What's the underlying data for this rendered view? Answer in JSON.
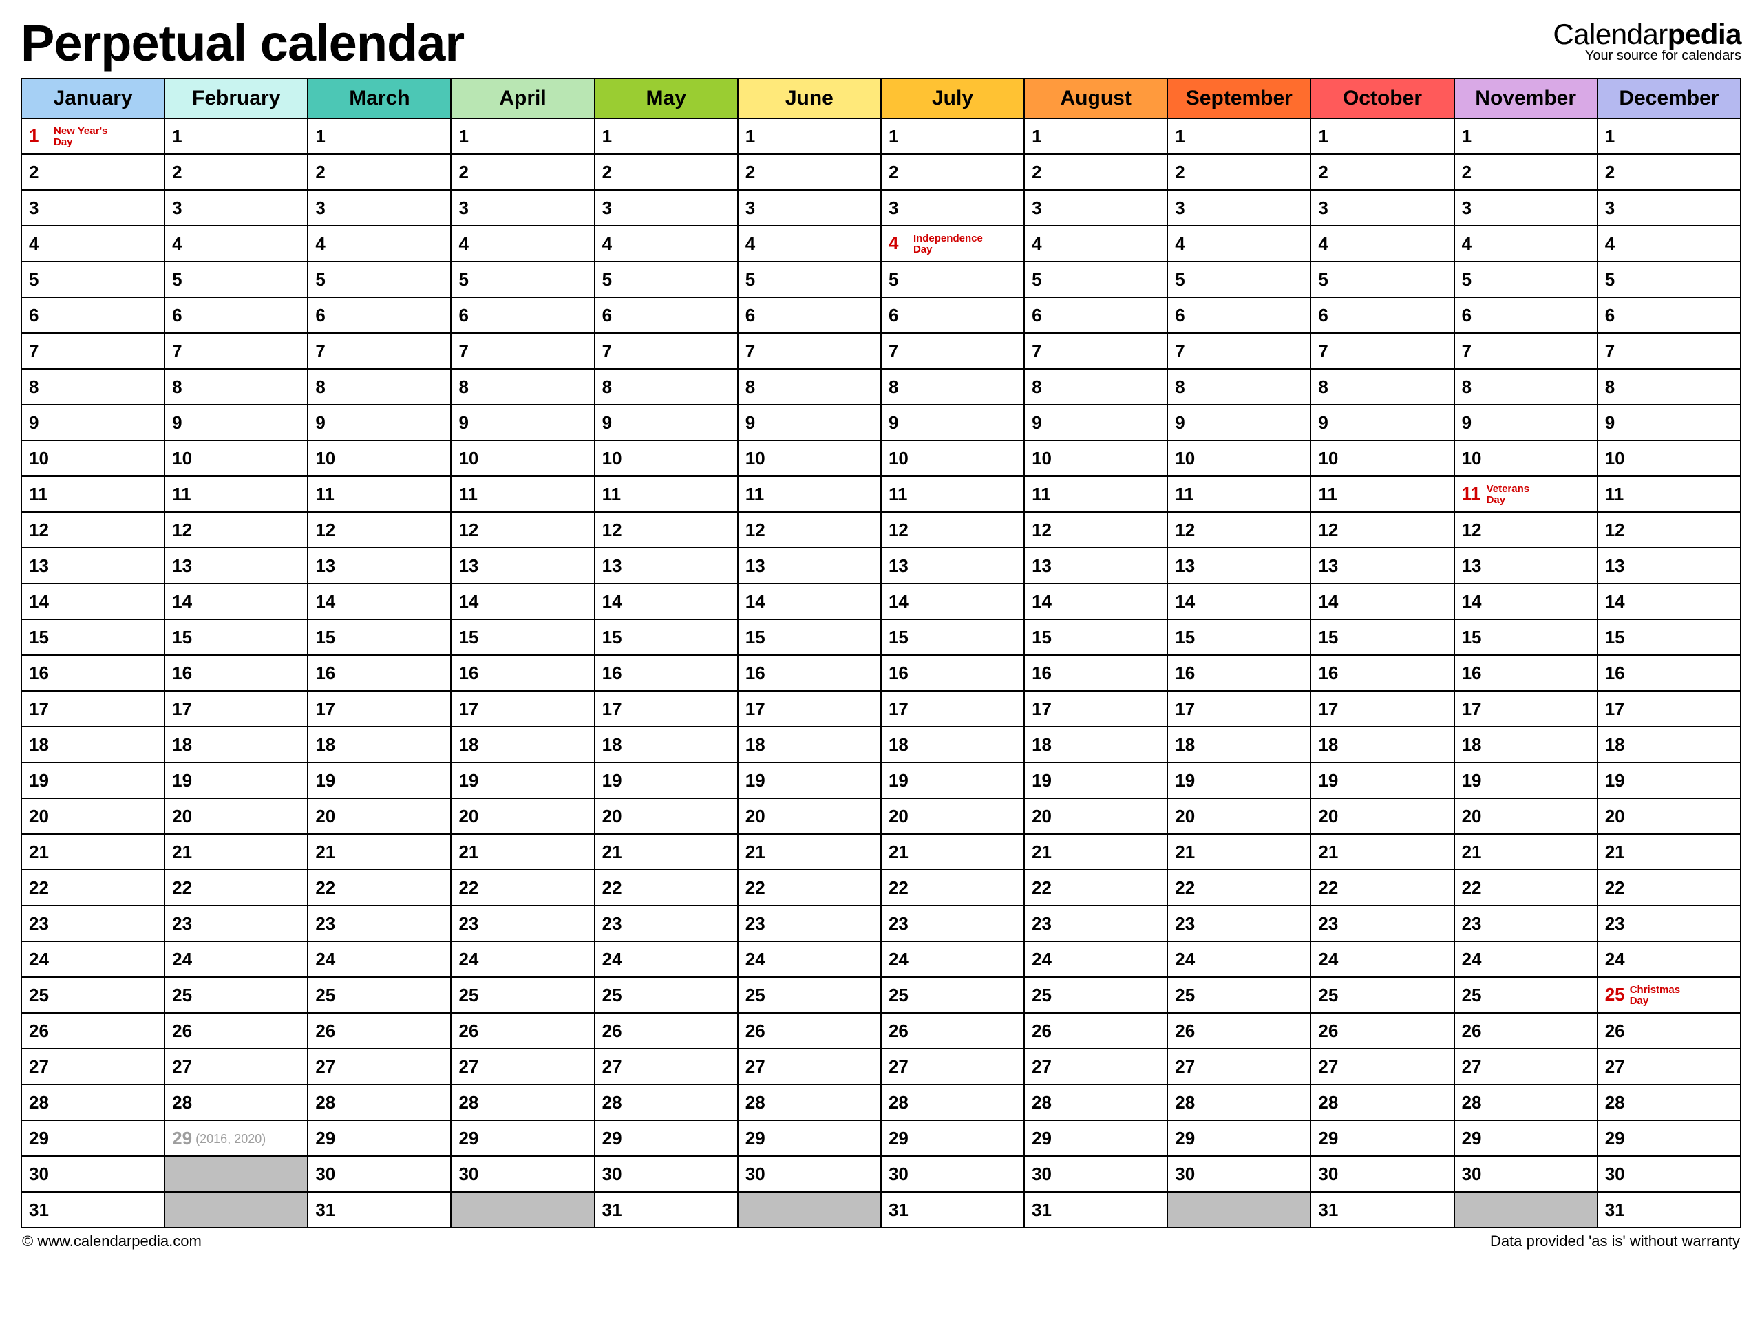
{
  "title": "Perpetual calendar",
  "logo": {
    "brand_a": "Calendar",
    "brand_b": "pedia",
    "tagline": "Your source for calendars"
  },
  "months": [
    {
      "name": "January",
      "color": "#a6d0f5",
      "days": 31
    },
    {
      "name": "February",
      "color": "#c9f4f0",
      "days": 29
    },
    {
      "name": "March",
      "color": "#4cc7b5",
      "days": 31
    },
    {
      "name": "April",
      "color": "#b9e6b3",
      "days": 30
    },
    {
      "name": "May",
      "color": "#9acd32",
      "days": 31
    },
    {
      "name": "June",
      "color": "#ffe97a",
      "days": 30
    },
    {
      "name": "July",
      "color": "#ffc233",
      "days": 31
    },
    {
      "name": "August",
      "color": "#ff9a3d",
      "days": 31
    },
    {
      "name": "September",
      "color": "#ff6d2d",
      "days": 30
    },
    {
      "name": "October",
      "color": "#ff5a5a",
      "days": 31
    },
    {
      "name": "November",
      "color": "#d9a9e6",
      "days": 30
    },
    {
      "name": "December",
      "color": "#b5b9f0",
      "days": 31
    }
  ],
  "max_rows": 31,
  "leap": {
    "month_index": 1,
    "day": 29,
    "note": "(2016, 2020)"
  },
  "holidays": [
    {
      "month_index": 0,
      "day": 1,
      "label": "New Year's Day"
    },
    {
      "month_index": 6,
      "day": 4,
      "label": "Independence Day"
    },
    {
      "month_index": 10,
      "day": 11,
      "label": "Veterans Day"
    },
    {
      "month_index": 11,
      "day": 25,
      "label": "Christmas Day"
    }
  ],
  "footer": {
    "left": "© www.calendarpedia.com",
    "right": "Data provided 'as is' without warranty"
  }
}
